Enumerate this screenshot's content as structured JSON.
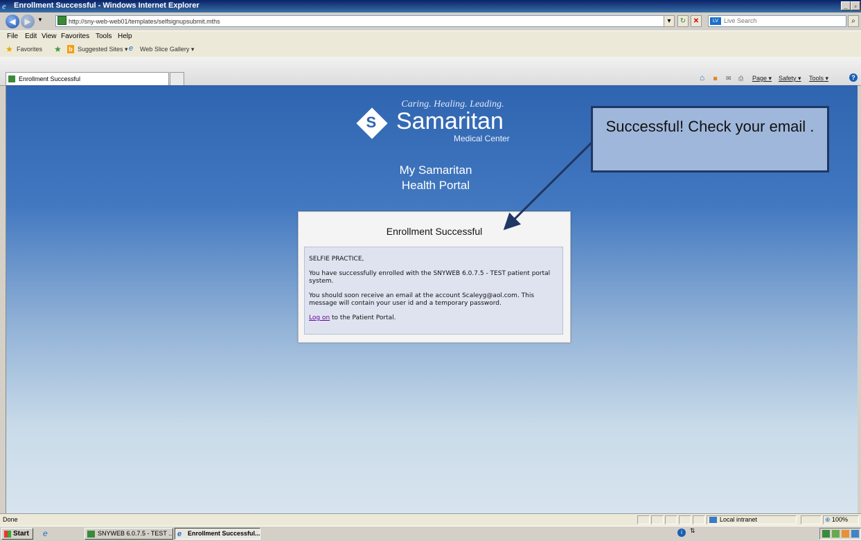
{
  "window": {
    "title": "Enrollment Successful - Windows Internet Explorer"
  },
  "address": {
    "url": "http://sny-web-web01/templates/selfsignupsubmit.mths"
  },
  "search": {
    "placeholder": "Live Search",
    "badge": "LV"
  },
  "menu": [
    "File",
    "Edit",
    "View",
    "Favorites",
    "Tools",
    "Help"
  ],
  "favorites_bar": {
    "favorites": "Favorites",
    "suggested": "Suggested Sites ▾",
    "webslice": "Web Slice Gallery ▾"
  },
  "tab": {
    "label": "Enrollment Successful"
  },
  "command_bar": {
    "page": "Page ▾",
    "safety": "Safety ▾",
    "tools": "Tools ▾"
  },
  "logo": {
    "tagline": "Caring. Healing. Leading.",
    "brand": "Samaritan",
    "subtitle": "Medical Center"
  },
  "portal": {
    "line1": "My Samaritan",
    "line2": "Health Portal"
  },
  "card": {
    "title": "Enrollment Successful",
    "greeting": "SELFIE PRACTICE,",
    "enrolled": "You have successfully enrolled with the SNYWEB 6.0.7.5 - TEST patient portal system.",
    "email_notice": "You should soon receive an email at the account Scaleyg@aol.com. This message will contain your user id and a temporary password.",
    "logon_link": "Log on",
    "logon_rest": " to the Patient Portal."
  },
  "callout": {
    "text": "Successful! Check your email ."
  },
  "status": {
    "left": "Done",
    "zone": "Local intranet",
    "zoom": "100%"
  },
  "taskbar": {
    "start": "Start",
    "item1": "SNYWEB 6.0.7.5 - TEST ...",
    "item2": "Enrollment Successful..."
  }
}
